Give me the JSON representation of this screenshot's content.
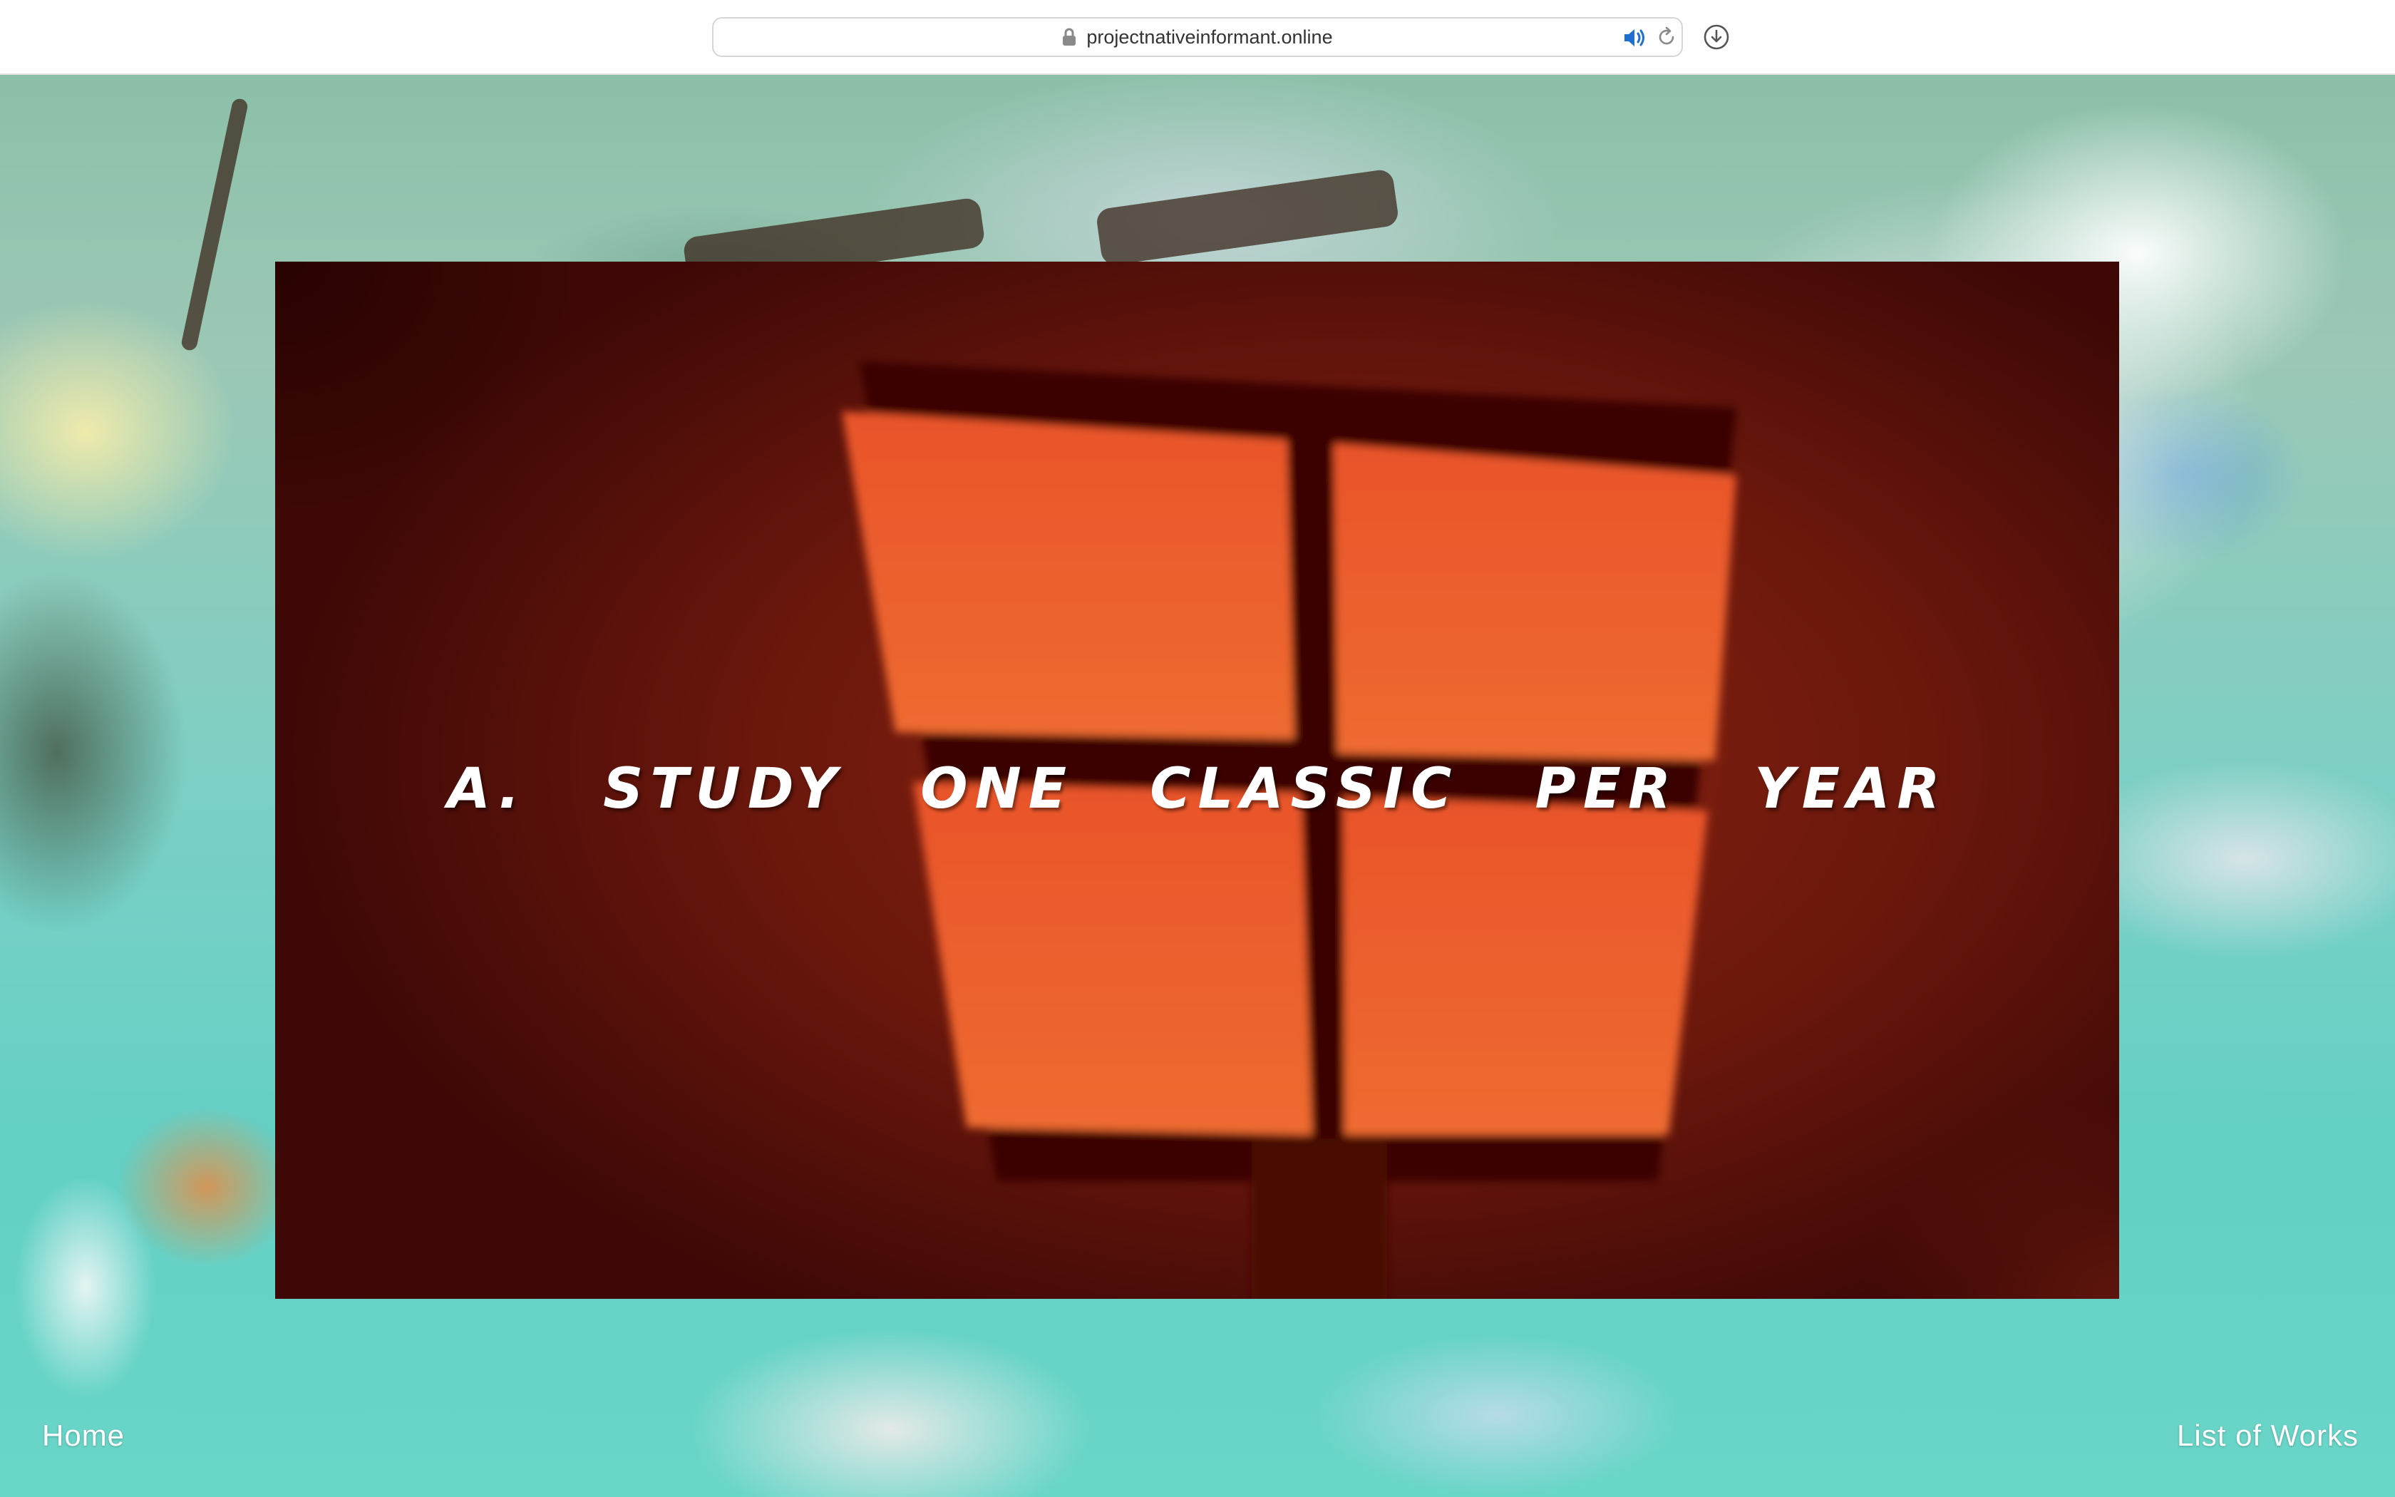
{
  "browser": {
    "url": "projectnativeinformant.online",
    "icons": {
      "lock": "lock-icon",
      "audio": "speaker-icon",
      "reload": "reload-icon",
      "downloads": "download-icon"
    },
    "accent_color": "#1f6fd1"
  },
  "video": {
    "caption": "A. STUDY ONE CLASSIC PER YEAR"
  },
  "nav": {
    "home_label": "Home",
    "works_label": "List of Works"
  },
  "colors": {
    "video_red": "#8d2512",
    "window_orange": "#ec5f2e",
    "background_teal": "#64d0c6"
  }
}
